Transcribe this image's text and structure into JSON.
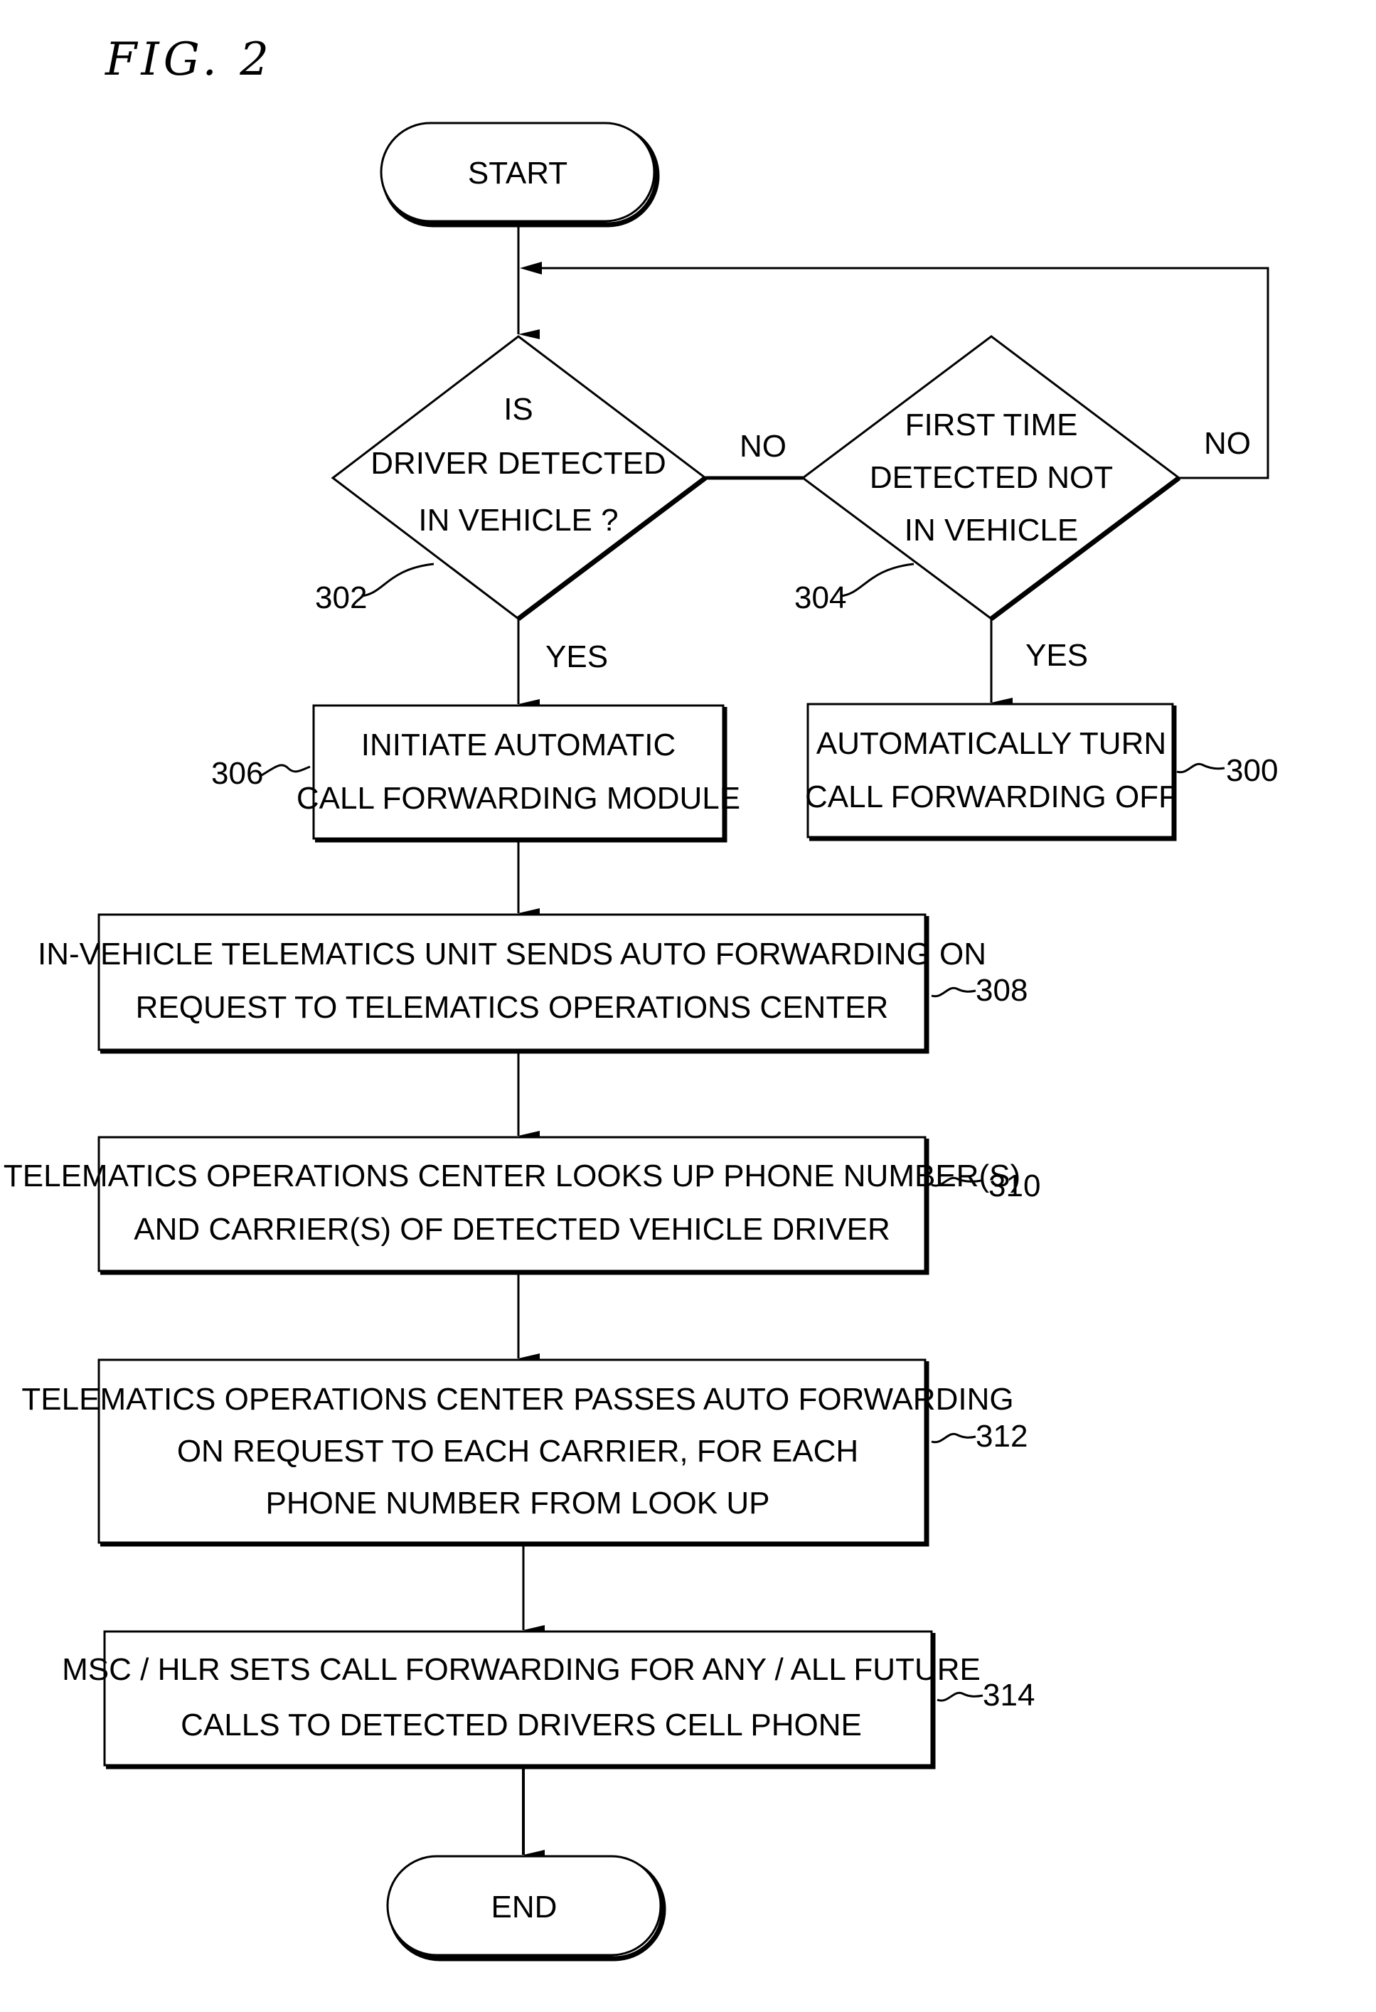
{
  "figure": {
    "title": "FIG. 2"
  },
  "nodes": {
    "start": {
      "type": "terminal",
      "label": "START"
    },
    "d302": {
      "type": "decision",
      "ref": "302",
      "lines": [
        "IS",
        "DRIVER DETECTED",
        "IN VEHICLE ?"
      ]
    },
    "d304": {
      "type": "decision",
      "ref": "304",
      "lines": [
        "FIRST TIME",
        "DETECTED NOT",
        "IN VEHICLE"
      ]
    },
    "p306": {
      "type": "process",
      "ref": "306",
      "lines": [
        "INITIATE AUTOMATIC",
        "CALL FORWARDING MODULE"
      ]
    },
    "p300": {
      "type": "process",
      "ref": "300",
      "lines": [
        "AUTOMATICALLY TURN",
        "CALL FORWARDING OFF"
      ]
    },
    "p308": {
      "type": "process",
      "ref": "308",
      "lines": [
        "IN-VEHICLE TELEMATICS UNIT SENDS AUTO FORWARDING ON",
        "REQUEST TO TELEMATICS OPERATIONS CENTER"
      ]
    },
    "p310": {
      "type": "process",
      "ref": "310",
      "lines": [
        "TELEMATICS OPERATIONS CENTER LOOKS UP PHONE NUMBER(S)",
        "AND CARRIER(S) OF DETECTED VEHICLE DRIVER"
      ]
    },
    "p312": {
      "type": "process",
      "ref": "312",
      "lines": [
        "TELEMATICS OPERATIONS CENTER PASSES AUTO FORWARDING",
        "ON REQUEST TO EACH CARRIER, FOR EACH",
        "PHONE NUMBER FROM LOOK UP"
      ]
    },
    "p314": {
      "type": "process",
      "ref": "314",
      "lines": [
        "MSC / HLR SETS CALL FORWARDING FOR ANY / ALL FUTURE",
        "CALLS TO DETECTED DRIVERS CELL PHONE"
      ]
    },
    "end": {
      "type": "terminal",
      "label": "END"
    }
  },
  "edges": [
    {
      "from": "start",
      "to": "d302",
      "label": ""
    },
    {
      "from": "d302",
      "to": "d304",
      "label": "NO"
    },
    {
      "from": "d304",
      "to": "d302",
      "label": "NO"
    },
    {
      "from": "d302",
      "to": "p306",
      "label": "YES"
    },
    {
      "from": "d304",
      "to": "p300",
      "label": "YES"
    },
    {
      "from": "p306",
      "to": "p308",
      "label": ""
    },
    {
      "from": "p308",
      "to": "p310",
      "label": ""
    },
    {
      "from": "p310",
      "to": "p312",
      "label": ""
    },
    {
      "from": "p312",
      "to": "p314",
      "label": ""
    },
    {
      "from": "p314",
      "to": "end",
      "label": ""
    }
  ],
  "edge_labels": {
    "d302_no": "NO",
    "d304_no": "NO",
    "d302_yes": "YES",
    "d304_yes": "YES"
  }
}
